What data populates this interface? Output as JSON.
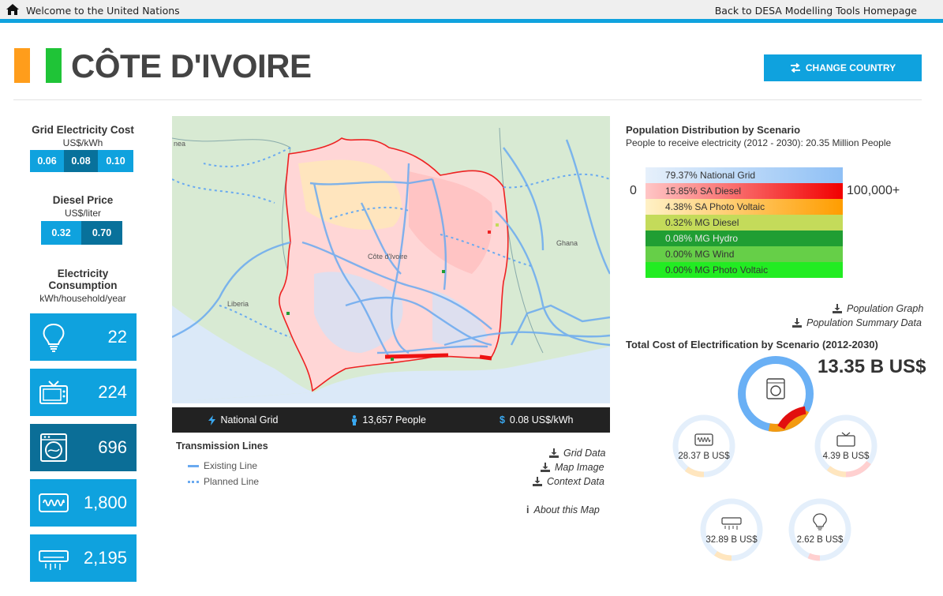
{
  "topbar": {
    "welcome": "Welcome to the United Nations",
    "back": "Back to DESA Modelling Tools Homepage"
  },
  "header": {
    "country": "CÔTE D'IVOIRE",
    "change_button": "CHANGE COUNTRY",
    "flag_colors": [
      "#ff9d1b",
      "#1fc437"
    ]
  },
  "grid_cost": {
    "title": "Grid Electricity Cost",
    "unit": "US$/kWh",
    "options": [
      "0.06",
      "0.08",
      "0.10"
    ],
    "selected": "0.08"
  },
  "diesel": {
    "title": "Diesel Price",
    "unit": "US$/liter",
    "options": [
      "0.32",
      "0.70"
    ],
    "selected": "0.70"
  },
  "consumption": {
    "title_line1": "Electricity",
    "title_line2": "Consumption",
    "unit": "kWh/household/year",
    "tiles": [
      {
        "icon": "lightbulb-icon",
        "value": "22"
      },
      {
        "icon": "tv-icon",
        "value": "224"
      },
      {
        "icon": "washing-machine-icon",
        "value": "696"
      },
      {
        "icon": "heater-icon",
        "value": "1,800"
      },
      {
        "icon": "air-conditioner-icon",
        "value": "2,195"
      }
    ],
    "selected": "696"
  },
  "map": {
    "labels": {
      "guinea": "nea",
      "liberia": "Liberia",
      "ghana": "Ghana",
      "country": "Côte d'Ivoire"
    },
    "bar": {
      "grid": "National Grid",
      "people": "13,657 People",
      "cost": "0.08 US$/kWh"
    }
  },
  "transmission": {
    "title": "Transmission Lines",
    "existing": "Existing Line",
    "planned": "Planned Line"
  },
  "downloads": {
    "grid": "Grid Data",
    "map": "Map Image",
    "context": "Context Data",
    "about": "About this Map",
    "pop_graph": "Population Graph",
    "pop_summary": "Population Summary Data"
  },
  "population": {
    "title": "Population Distribution by Scenario",
    "subtitle": "People to receive electricity (2012 - 2030): 20.35 Million People",
    "legend_min": "0",
    "legend_max": "100,000+",
    "scenarios": [
      {
        "label": "79.37% National Grid",
        "from": "#e6f0fb",
        "to": "#8fc0f5"
      },
      {
        "label": "15.85% SA Diesel",
        "from": "#ffc6c6",
        "to": "#f20000"
      },
      {
        "label": "4.38% SA Photo Voltaic",
        "from": "#fff1c6",
        "to": "#ff9d00"
      },
      {
        "label": "0.32% MG Diesel",
        "from": "#c4db5a",
        "to": "#c4db5a"
      },
      {
        "label": "0.08% MG Hydro",
        "from": "#209e33",
        "to": "#209e33"
      },
      {
        "label": "0.00% MG Wind",
        "from": "#66cf48",
        "to": "#66cf48"
      },
      {
        "label": "0.00% MG Photo Voltaic",
        "from": "#22ec22",
        "to": "#22ec22"
      }
    ]
  },
  "cost": {
    "title": "Total Cost of Electrification by Scenario (2012-2030)",
    "total": "13.35 B US$",
    "main_shares": {
      "grid": 0.7,
      "pv": 0.2,
      "diesel": 0.05
    },
    "donuts": [
      {
        "name": "heater",
        "value": "28.37 B US$"
      },
      {
        "name": "tv",
        "value": "4.39 B US$"
      },
      {
        "name": "air-conditioner",
        "value": "32.89 B US$"
      },
      {
        "name": "lightbulb",
        "value": "2.62 B US$"
      }
    ]
  }
}
